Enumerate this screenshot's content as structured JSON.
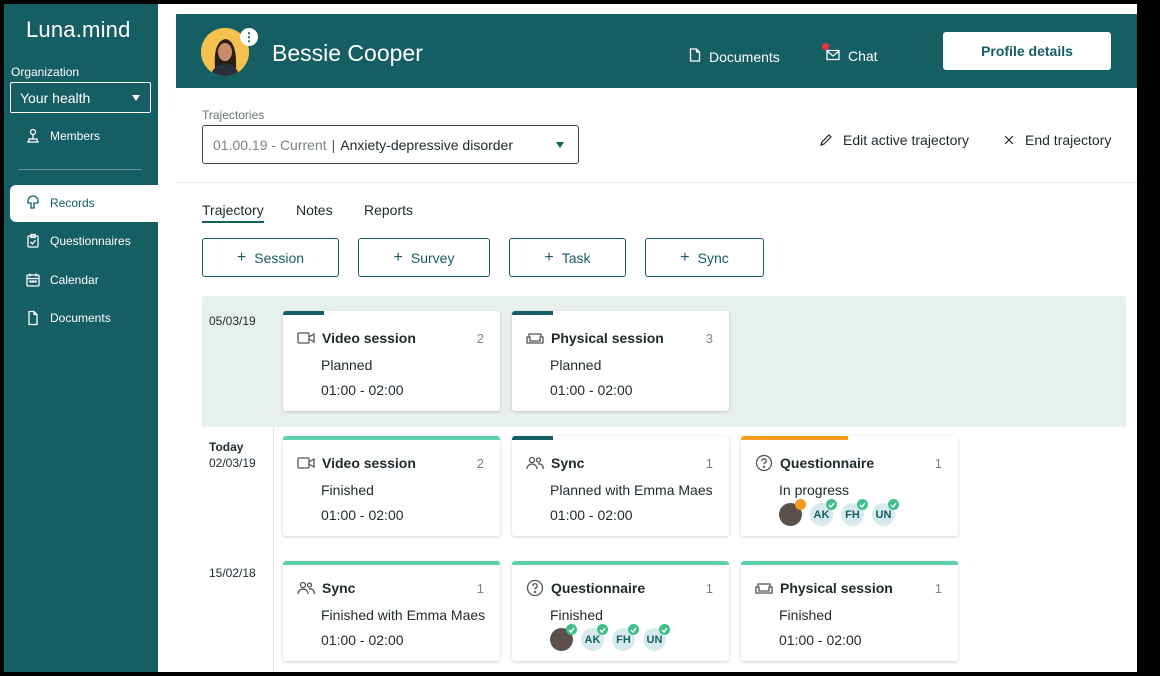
{
  "app": {
    "name": "Luna.mind"
  },
  "sidebar": {
    "org_label": "Organization",
    "org_value": "Your health",
    "items": [
      {
        "label": "Members",
        "icon": "members-icon"
      },
      {
        "label": "Records",
        "icon": "records-icon",
        "active": true
      },
      {
        "label": "Questionnaires",
        "icon": "clipboard-icon"
      },
      {
        "label": "Calendar",
        "icon": "calendar-icon"
      },
      {
        "label": "Documents",
        "icon": "document-icon"
      }
    ]
  },
  "header": {
    "patient_name": "Bessie Cooper",
    "documents_label": "Documents",
    "chat_label": "Chat",
    "profile_button": "Profile details"
  },
  "trajectory": {
    "label": "Trajectories",
    "period": "01.00.19 - Current",
    "name": "Anxiety-depressive disorder",
    "edit_label": "Edit active trajectory",
    "end_label": "End trajectory"
  },
  "tabs": [
    "Trajectory",
    "Notes",
    "Reports"
  ],
  "add_buttons": [
    "Session",
    "Survey",
    "Task",
    "Sync"
  ],
  "colors": {
    "brand": "#155e63",
    "green": "#5fd1a6",
    "orange": "#f39c1f",
    "band": "#e8f0ee"
  },
  "timeline": [
    {
      "date_top": "",
      "date": "05/03/19",
      "cards": [
        {
          "title": "Video session",
          "count": "2",
          "status": "Planned",
          "time": "01:00 - 02:00",
          "icon": "video-icon",
          "bar": "brand-short"
        },
        {
          "title": "Physical session",
          "count": "3",
          "status": "Planned",
          "time": "01:00 - 02:00",
          "icon": "sofa-icon",
          "bar": "brand-short"
        }
      ]
    },
    {
      "date_top": "Today",
      "date": "02/03/19",
      "cards": [
        {
          "title": "Video session",
          "count": "2",
          "status": "Finished",
          "time": "01:00 - 02:00",
          "icon": "video-icon",
          "bar": "green-full"
        },
        {
          "title": "Sync",
          "count": "1",
          "status": "Planned with Emma Maes",
          "time": "01:00 - 02:00",
          "icon": "people-icon",
          "bar": "brand-short"
        },
        {
          "title": "Questionnaire",
          "count": "1",
          "status": "In progress",
          "people": [
            "AK",
            "FH",
            "UN"
          ],
          "icon": "question-icon",
          "bar": "orange-half"
        }
      ]
    },
    {
      "date_top": "",
      "date": "15/02/18",
      "cards": [
        {
          "title": "Sync",
          "count": "1",
          "status": "Finished with Emma Maes",
          "time": "01:00 - 02:00",
          "icon": "people-icon",
          "bar": "green-full"
        },
        {
          "title": "Questionnaire",
          "count": "1",
          "status": "Finished",
          "people": [
            "AK",
            "FH",
            "UN"
          ],
          "icon": "question-icon",
          "bar": "green-full"
        },
        {
          "title": "Physical session",
          "count": "1",
          "status": "Finished",
          "time": "01:00 - 02:00",
          "icon": "sofa-icon",
          "bar": "green-full"
        }
      ]
    }
  ]
}
